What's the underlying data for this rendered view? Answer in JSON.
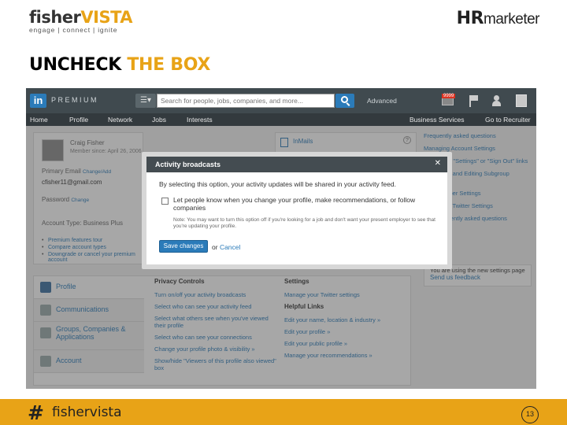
{
  "header": {
    "logo_left_main_a": "fisher",
    "logo_left_main_b": "VISTA",
    "logo_left_sub": "engage | connect | ignite",
    "logo_right_a": "HR",
    "logo_right_b": "marketer",
    "title_black": "UNCHECK",
    "title_gold": " THE BOX"
  },
  "linkedin": {
    "logo": "in",
    "premium": "PREMIUM",
    "search_placeholder": "Search for people, jobs, companies, and more...",
    "advanced": "Advanced",
    "mail_badge": "9999",
    "nav": [
      "Home",
      "Profile",
      "Network",
      "Jobs",
      "Interests",
      "Business Services",
      "Go to Recruiter"
    ],
    "account": {
      "name": "Craig Fisher",
      "member_since": "Member since: April 26, 2006",
      "primary_email_label": "Primary Email",
      "primary_email_link": "Change/Add",
      "email": "cfisher11@gmail.com",
      "password_label": "Password",
      "password_link": "Change",
      "account_type": "Account Type: Business Plus",
      "links": [
        "Premium features tour",
        "Compare account types",
        "Downgrade or cancel your premium account"
      ]
    },
    "mid": {
      "inmails": "InMails",
      "help": "?"
    },
    "faq": [
      "Frequently asked questions",
      "Managing Account Settings",
      "\"Print\" and \"Settings\" or \"Sign Out\" links",
      "Reviewing and Editing Subgroup Settings",
      "Join Member Settings",
      "Publishing Twitter Settings",
      "Find frequently asked questions"
    ],
    "note": {
      "text": "You are using the new settings page",
      "link": "Send us feedback"
    },
    "tabs": [
      "Profile",
      "Communications",
      "Groups, Companies & Applications",
      "Account"
    ],
    "privacy": {
      "heading": "Privacy Controls",
      "links": [
        "Turn on/off your activity broadcasts",
        "Select who can see your activity feed",
        "Select what others see when you've viewed their profile",
        "Select who can see your connections",
        "Change your profile photo & visibility »",
        "Show/hide \"Viewers of this profile also viewed\" box"
      ]
    },
    "settings": {
      "heading": "Settings",
      "links": [
        "Manage your Twitter settings"
      ],
      "helpful_heading": "Helpful Links",
      "helpful_links": [
        "Edit your name, location & industry »",
        "Edit your profile »",
        "Edit your public profile »",
        "Manage your recommendations »"
      ]
    },
    "modal": {
      "title": "Activity broadcasts",
      "close": "✕",
      "desc": "By selecting this option, your activity updates will be shared in your activity feed.",
      "checkbox_label": "Let people know when you change your profile, make recommendations, or follow companies",
      "note": "Note: You may want to turn this option off if you're looking for a job and don't want your present employer to see that you're updating your profile.",
      "save": "Save changes",
      "or": "or",
      "cancel": "Cancel"
    }
  },
  "footer": {
    "hash": "#",
    "brand": "fishervista",
    "page": "13"
  }
}
